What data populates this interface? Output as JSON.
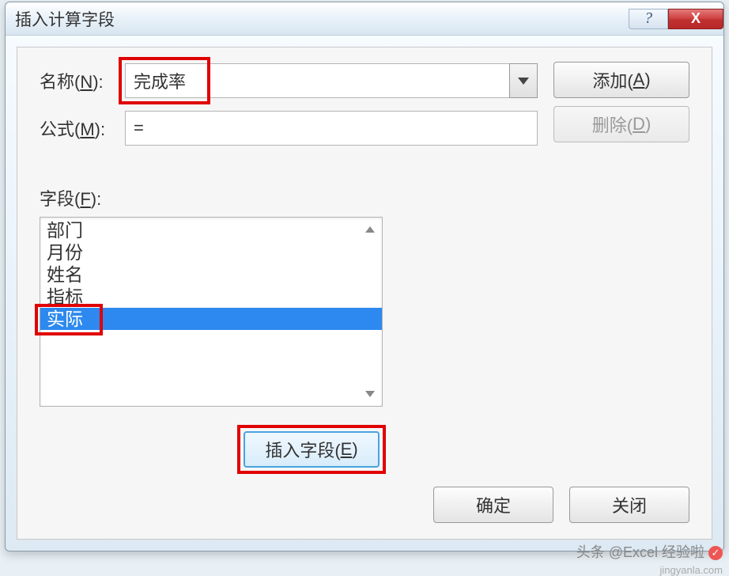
{
  "title": "插入计算字段",
  "titlebar": {
    "help_label": "?",
    "close_label": "X"
  },
  "labels": {
    "name": "名称(",
    "name_u": "N",
    "name_end": "):",
    "formula": "公式(",
    "formula_u": "M",
    "formula_end": "):",
    "fields": "字段(",
    "fields_u": "F",
    "fields_end": "):"
  },
  "inputs": {
    "name_value": "完成率",
    "formula_value": "="
  },
  "buttons": {
    "add": "添加(",
    "add_u": "A",
    "add_end": ")",
    "delete": "删除(",
    "delete_u": "D",
    "delete_end": ")",
    "insert": "插入字段(",
    "insert_u": "E",
    "insert_end": ")",
    "ok": "确定",
    "close": "关闭"
  },
  "field_list": {
    "items": [
      "部门",
      "月份",
      "姓名",
      "指标",
      "实际"
    ],
    "selected_index": 4
  },
  "watermark": {
    "text": "头条 @Excel 经验啦",
    "site": "jingyanla.com"
  }
}
